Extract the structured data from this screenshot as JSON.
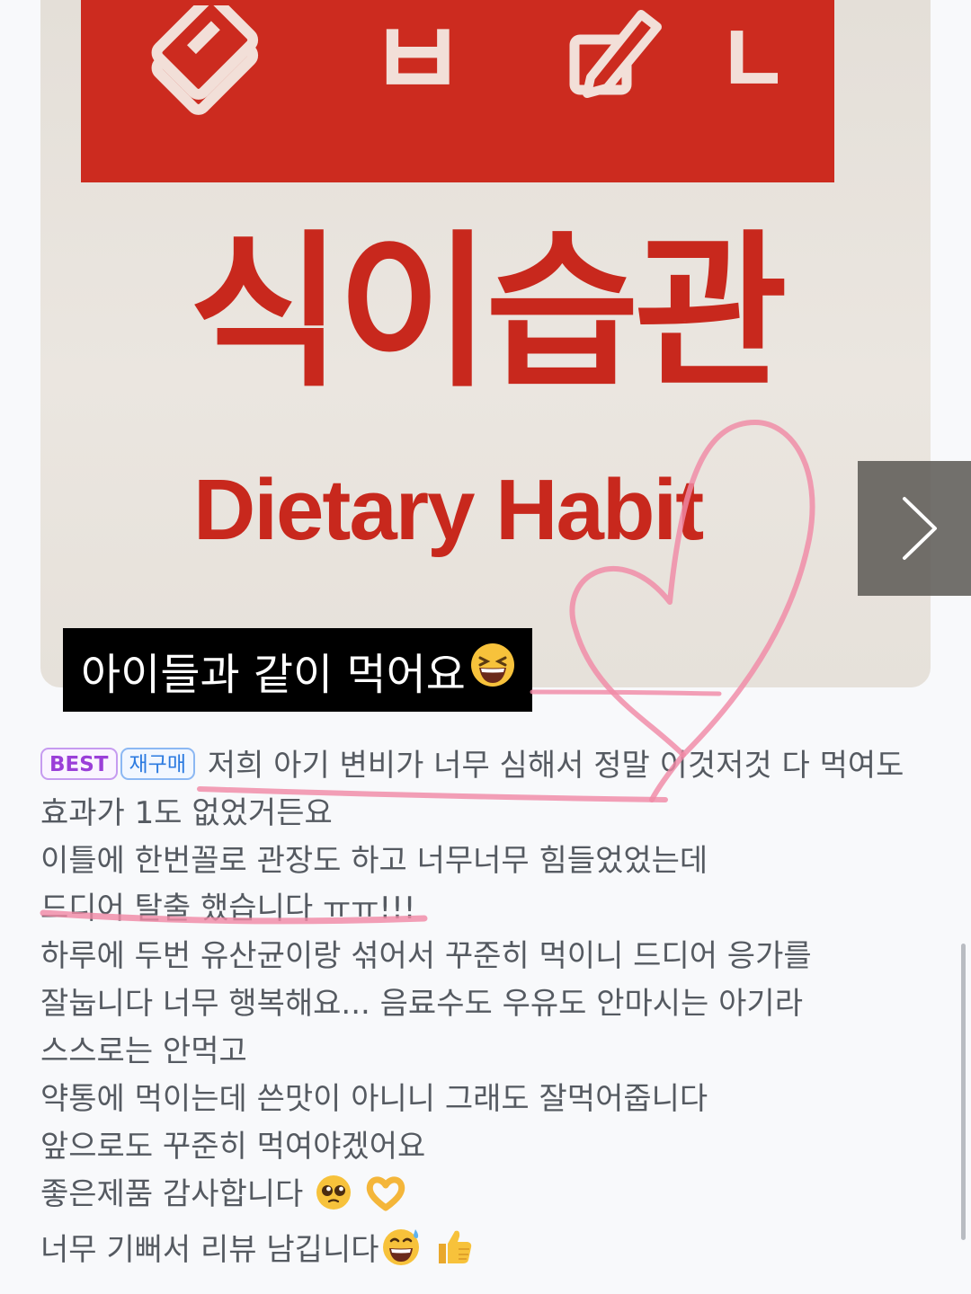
{
  "photo": {
    "band_letters": [
      "ㅂ",
      "ㄴ"
    ],
    "headline_ko": "식이습관",
    "headline_en": "Dietary Habit",
    "caption": "아이들과 같이 먹어요",
    "caption_emoji": "grinning-squinting-face",
    "colors": {
      "brand_red": "#cc2b1f",
      "marker_pink": "#f08aa6"
    }
  },
  "carousel": {
    "next_icon": "chevron-right-icon"
  },
  "review": {
    "badges": {
      "best": "BEST",
      "rebuy": "재구매"
    },
    "lines": [
      "저희 아기 변비가 너무 심해서 정말 이것저것 다 먹여도",
      "효과가 1도 없었거든요",
      "이틀에 한번꼴로 관장도 하고 너무너무 힘들었었는데",
      "드디어 탈출 했습니다 ㅠㅠ!!!",
      "하루에 두번 유산균이랑 섞어서 꾸준히 먹이니 드디어 응가를",
      "잘눕니다 너무 행복해요... 음료수도 우유도 안마시는 아기라",
      "스스로는 안먹고",
      "약통에 먹이는데 쓴맛이 아니니 그래도 잘먹어줍니다",
      "앞으로도 꾸준히 먹여야겠어요",
      "좋은제품 감사합니다",
      "너무 기뻐서 리뷰 남깁니다"
    ],
    "emojis": {
      "thanks": [
        "pleading-face",
        "heart-hands"
      ],
      "happy": [
        "grinning-sweat-face",
        "thumbs-up"
      ]
    }
  }
}
